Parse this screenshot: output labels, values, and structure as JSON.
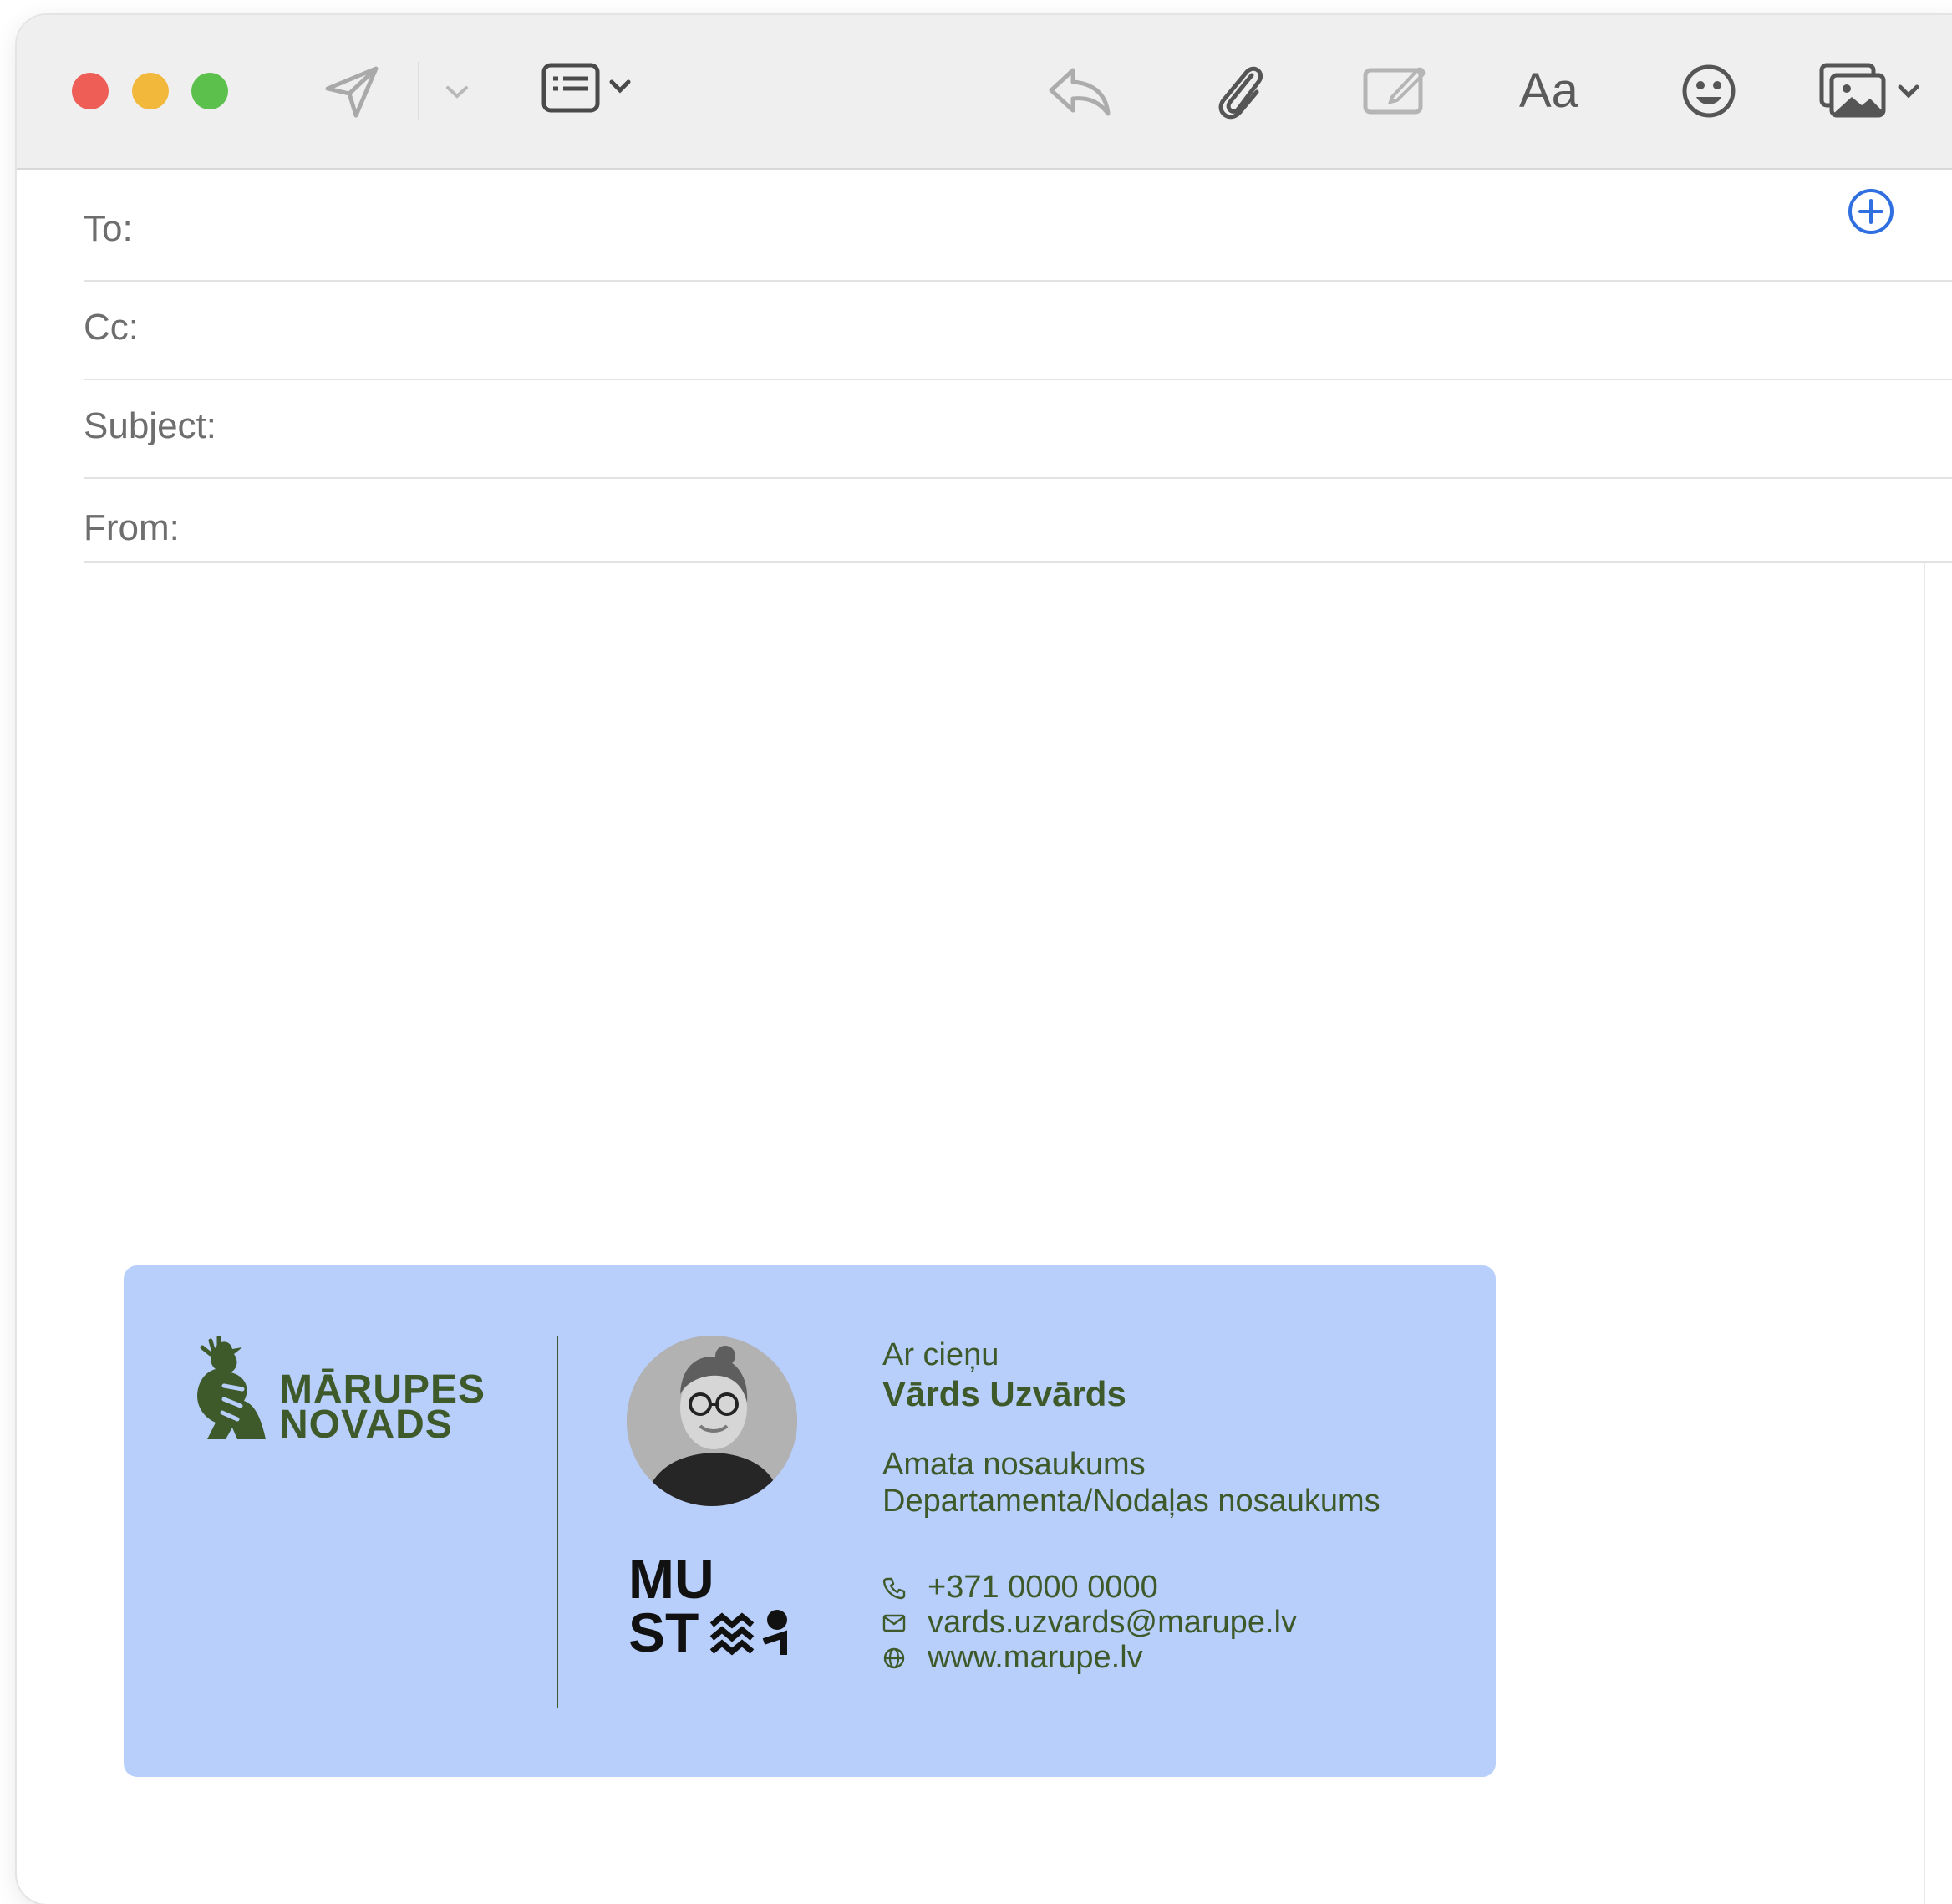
{
  "toolbar": {
    "icons": [
      "send-icon",
      "chevron-down-icon",
      "header-fields-icon",
      "reply-icon",
      "paperclip-icon",
      "markup-icon",
      "format-icon",
      "emoji-icon",
      "photo-browser-icon"
    ],
    "format_label": "Aa"
  },
  "header": {
    "to_label": "To:",
    "cc_label": "Cc:",
    "subject_label": "Subject:",
    "from_label": "From:"
  },
  "signature": {
    "background_color": "#b8cffc",
    "text_color": "#3f5a2a",
    "brand_line1": "MĀRUPES",
    "brand_line2": "NOVADS",
    "must_logo": "MUST",
    "greeting": "Ar cieņu",
    "name": "Vārds Uzvārds",
    "position": "Amata nosaukums",
    "department": "Departamenta/Nodaļas nosaukums",
    "phone": "+371 0000 0000",
    "email": "vards.uzvards@marupe.lv",
    "website": "www.marupe.lv"
  }
}
